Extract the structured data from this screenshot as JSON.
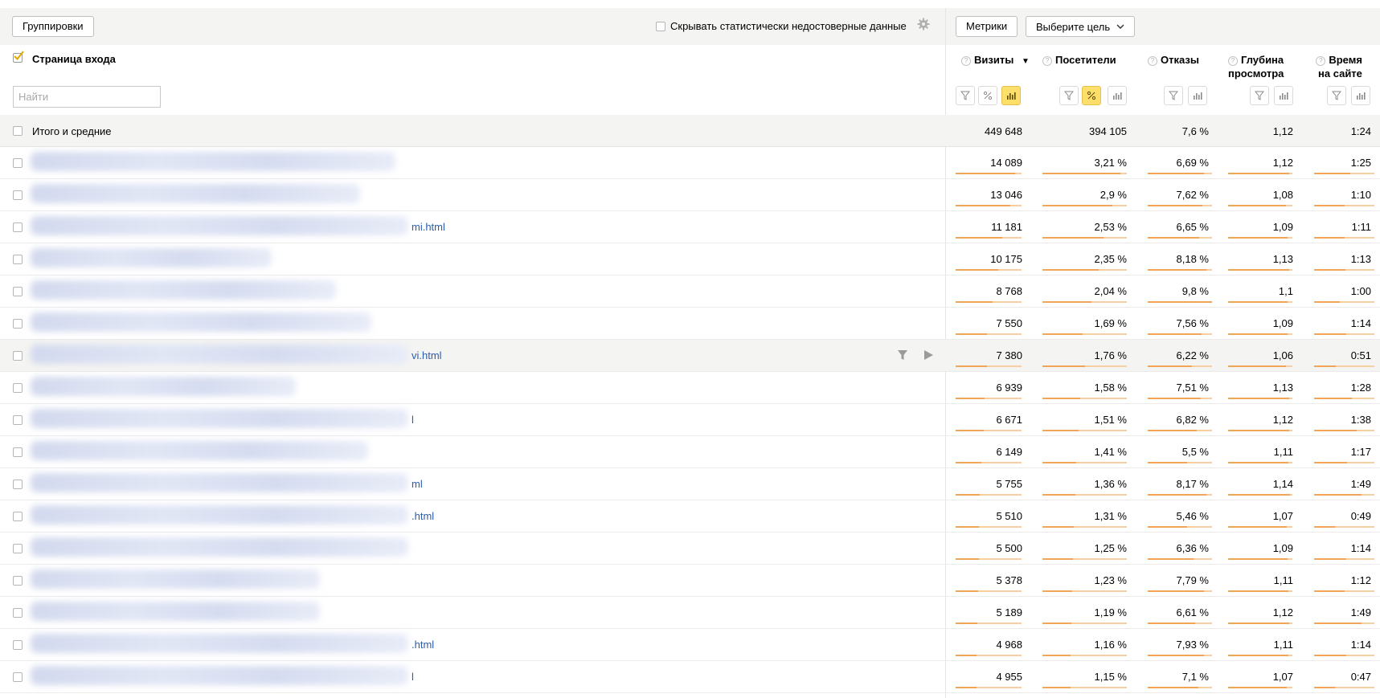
{
  "toolbar": {
    "groupings_label": "Группировки",
    "hide_unreliable_label": "Скрывать статистически недостоверные данные",
    "metrics_label": "Метрики",
    "goal_label": "Выберите цель"
  },
  "dimension": {
    "label": "Страница входа",
    "search_placeholder": "Найти"
  },
  "columns": [
    {
      "label_line1": "Визиты",
      "label_line2": "",
      "sorted": true,
      "sort_glyph": "▼"
    },
    {
      "label_line1": "Посетители",
      "label_line2": ""
    },
    {
      "label_line1": "Отказы",
      "label_line2": ""
    },
    {
      "label_line1": "Глубина",
      "label_line2": "просмотра"
    },
    {
      "label_line1": "Время",
      "label_line2": "на сайте"
    }
  ],
  "totals": {
    "label": "Итого и средние",
    "visits": "449 648",
    "visitors": "394 105",
    "bounce": "7,6 %",
    "depth": "1,12",
    "time": "1:24"
  },
  "rows": [
    {
      "link_tail": "",
      "visits": "14 089",
      "visitors": "3,21 %",
      "bounce": "6,69 %",
      "depth": "1,12",
      "time": "1:25",
      "bars": [
        0.9,
        0.92,
        0.88,
        0.95,
        0.6
      ]
    },
    {
      "link_tail": "",
      "visits": "13 046",
      "visitors": "2,9 %",
      "bounce": "7,62 %",
      "depth": "1,08",
      "time": "1:10",
      "bars": [
        0.83,
        0.83,
        0.85,
        0.9,
        0.5
      ]
    },
    {
      "link_tail": "mi.html",
      "visits": "11 181",
      "visitors": "2,53 %",
      "bounce": "6,65 %",
      "depth": "1,09",
      "time": "1:11",
      "bars": [
        0.71,
        0.72,
        0.8,
        0.92,
        0.5
      ]
    },
    {
      "link_tail": "",
      "visits": "10 175",
      "visitors": "2,35 %",
      "bounce": "8,18 %",
      "depth": "1,13",
      "time": "1:13",
      "bars": [
        0.65,
        0.67,
        0.91,
        0.95,
        0.52
      ]
    },
    {
      "link_tail": "",
      "visits": "8 768",
      "visitors": "2,04 %",
      "bounce": "9,8 %",
      "depth": "1,1",
      "time": "1:00",
      "bars": [
        0.56,
        0.58,
        1.0,
        0.93,
        0.43
      ]
    },
    {
      "link_tail": "",
      "visits": "7 550",
      "visitors": "1,69 %",
      "bounce": "7,56 %",
      "depth": "1,09",
      "time": "1:14",
      "bars": [
        0.48,
        0.48,
        0.84,
        0.92,
        0.53
      ]
    },
    {
      "link_tail": "vi.html",
      "visits": "7 380",
      "visitors": "1,76 %",
      "bounce": "6,22 %",
      "depth": "1,06",
      "time": "0:51",
      "bars": [
        0.47,
        0.5,
        0.69,
        0.9,
        0.36
      ],
      "highlighted": true
    },
    {
      "link_tail": "",
      "visits": "6 939",
      "visitors": "1,58 %",
      "bounce": "7,51 %",
      "depth": "1,13",
      "time": "1:28",
      "bars": [
        0.44,
        0.45,
        0.83,
        0.95,
        0.63
      ]
    },
    {
      "link_tail": "l",
      "visits": "6 671",
      "visitors": "1,51 %",
      "bounce": "6,82 %",
      "depth": "1,12",
      "time": "1:38",
      "bars": [
        0.43,
        0.43,
        0.76,
        0.95,
        0.7
      ]
    },
    {
      "link_tail": "",
      "visits": "6 149",
      "visitors": "1,41 %",
      "bounce": "5,5 %",
      "depth": "1,11",
      "time": "1:17",
      "bars": [
        0.39,
        0.4,
        0.61,
        0.94,
        0.55
      ]
    },
    {
      "link_tail": "ml",
      "visits": "5 755",
      "visitors": "1,36 %",
      "bounce": "8,17 %",
      "depth": "1,14",
      "time": "1:49",
      "bars": [
        0.37,
        0.39,
        0.91,
        0.96,
        0.78
      ]
    },
    {
      "link_tail": ".html",
      "visits": "5 510",
      "visitors": "1,31 %",
      "bounce": "5,46 %",
      "depth": "1,07",
      "time": "0:49",
      "bars": [
        0.35,
        0.37,
        0.61,
        0.91,
        0.35
      ]
    },
    {
      "link_tail": "",
      "visits": "5 500",
      "visitors": "1,25 %",
      "bounce": "6,36 %",
      "depth": "1,09",
      "time": "1:14",
      "bars": [
        0.35,
        0.36,
        0.71,
        0.92,
        0.53
      ]
    },
    {
      "link_tail": "",
      "visits": "5 378",
      "visitors": "1,23 %",
      "bounce": "7,79 %",
      "depth": "1,11",
      "time": "1:12",
      "bars": [
        0.34,
        0.35,
        0.87,
        0.94,
        0.51
      ]
    },
    {
      "link_tail": "",
      "visits": "5 189",
      "visitors": "1,19 %",
      "bounce": "6,61 %",
      "depth": "1,12",
      "time": "1:49",
      "bars": [
        0.33,
        0.34,
        0.74,
        0.95,
        0.78
      ]
    },
    {
      "link_tail": ".html",
      "visits": "4 968",
      "visitors": "1,16 %",
      "bounce": "7,93 %",
      "depth": "1,11",
      "time": "1:14",
      "bars": [
        0.32,
        0.33,
        0.88,
        0.94,
        0.53
      ]
    },
    {
      "link_tail": "l",
      "visits": "4 955",
      "visitors": "1,15 %",
      "bounce": "7,1 %",
      "depth": "1,07",
      "time": "0:47",
      "bars": [
        0.32,
        0.33,
        0.79,
        0.91,
        0.34
      ]
    }
  ],
  "colors": {
    "accent_yellow": "#ffdf6b",
    "bar_fill": "#f0a558",
    "bar_track": "#f7cfa3",
    "link": "#2a5db0",
    "header_bg": "#f4f4f2"
  },
  "icons": {
    "settings": "gear-icon",
    "filter": "filter-icon",
    "percent": "percent-icon",
    "bars": "bar-chart-icon",
    "play": "play-icon"
  }
}
